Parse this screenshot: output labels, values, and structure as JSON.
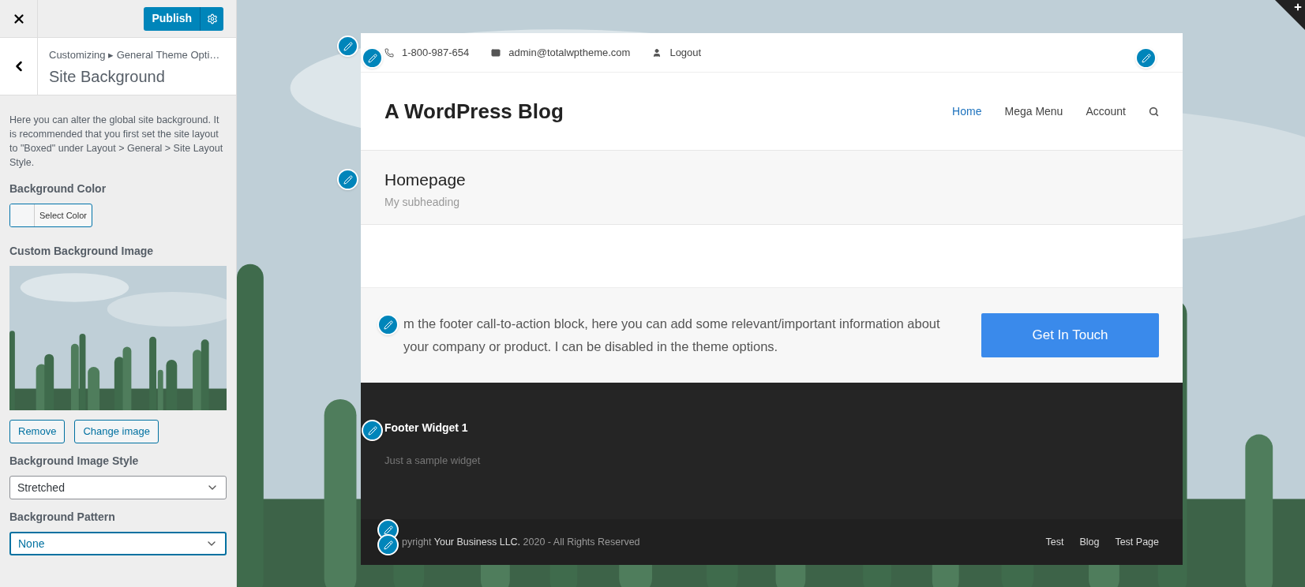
{
  "sidebar": {
    "publish_button": "Publish",
    "breadcrumb": "Customizing ▸ General Theme Opti…",
    "title": "Site Background",
    "description": "Here you can alter the global site background. It is recommended that you first set the site layout to \"Boxed\" under Layout > General > Site Layout Style.",
    "fields": [
      {
        "kind": "color",
        "label": "Background Color",
        "button": "Select Color"
      },
      {
        "label": "Custom Background Image",
        "image": {
          "kind": "picture"
        },
        "buttons": [
          "Remove",
          "Change image"
        ]
      },
      {
        "kind": "select",
        "label": "Background Image Style",
        "value": "Stretched",
        "focused": false
      },
      {
        "kind": "select",
        "label": "Background Pattern",
        "value": "None",
        "focused": true
      }
    ]
  },
  "preview": {
    "topbar": [
      {
        "kind": "phone",
        "text": "1-800-987-654"
      },
      {
        "kind": "email",
        "text": "admin@totalwptheme.com"
      },
      {
        "kind": "user",
        "text": "Logout"
      }
    ],
    "logo": "A WordPress Blog",
    "nav": [
      {
        "label": "Home",
        "selected": true
      },
      {
        "label": "Mega Menu",
        "selected": false
      },
      {
        "label": "Account",
        "selected": false
      }
    ],
    "page_header": {
      "title": "Homepage",
      "subtitle": "My subheading"
    },
    "cta": {
      "text": "m the footer call-to-action block, here you can add some relevant/important information about your company or product. I can be disabled in the theme options.",
      "button": "Get In Touch"
    },
    "footer_widget": {
      "title": "Footer Widget 1",
      "text": "Just a sample widget"
    },
    "copyright": {
      "before": "pyright ",
      "link": "Your Business LLC.",
      "after": " 2020 - All Rights Reserved"
    },
    "footer_links": [
      "Test",
      "Blog",
      "Test Page"
    ]
  }
}
